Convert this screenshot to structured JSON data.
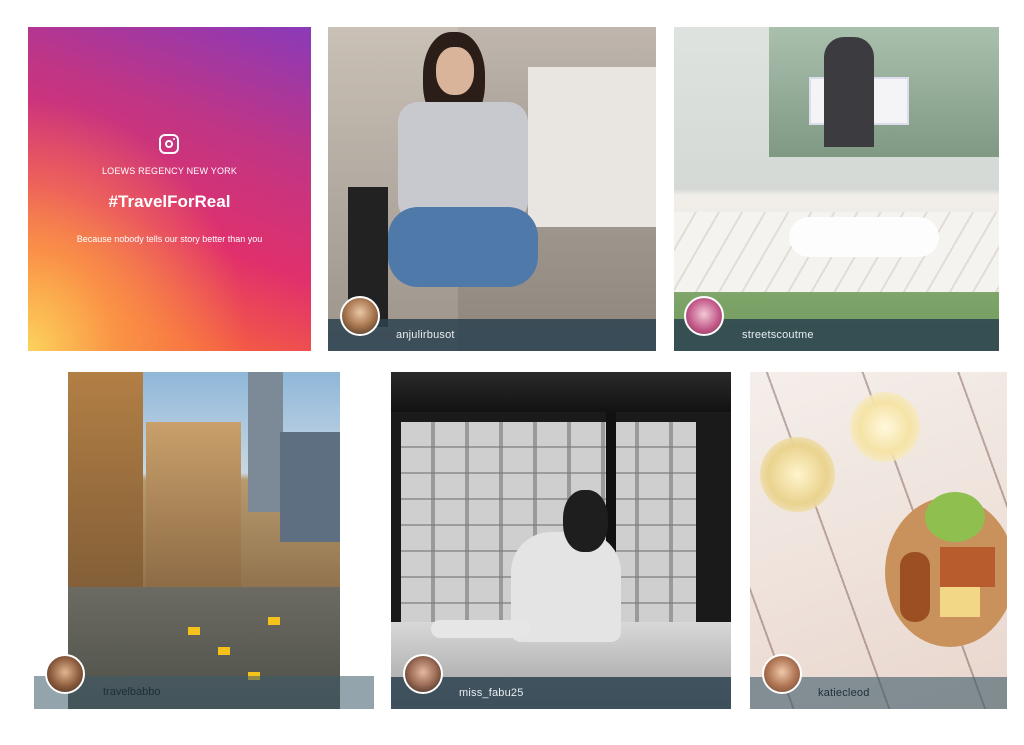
{
  "promo": {
    "brand": "LOEWS REGENCY NEW YORK",
    "hashtag": "#TravelForReal",
    "tagline": "Because nobody tells our story better than you",
    "icon": "instagram-icon"
  },
  "posts": [
    {
      "username": "anjulirbusot"
    },
    {
      "username": "streetscoutme"
    },
    {
      "username": "travelbabbo"
    },
    {
      "username": "miss_fabu25"
    },
    {
      "username": "katiecleod"
    }
  ],
  "colors": {
    "caption_bar": "#2b4250",
    "gradient": [
      "#8a3ab9",
      "#c13584",
      "#e1306c",
      "#f56040",
      "#fcd35c"
    ]
  }
}
